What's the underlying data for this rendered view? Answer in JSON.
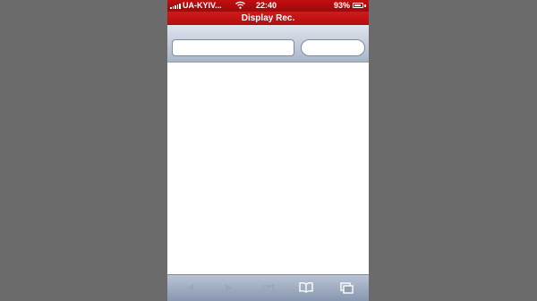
{
  "status_bar": {
    "carrier": "UA-KYIV...",
    "time": "22:40",
    "battery_percent": "93%",
    "battery_level": 0.93,
    "signal_icon": "signal-bars-icon",
    "wifi_icon": "wifi-icon",
    "battery_icon": "battery-icon"
  },
  "title_bar": {
    "title": "Display Rec."
  },
  "url_toolbar": {
    "address_value": "",
    "search_value": ""
  },
  "bottom_toolbar": {
    "buttons": [
      {
        "icon": "back-arrow-icon",
        "enabled": false
      },
      {
        "icon": "forward-arrow-icon",
        "enabled": false
      },
      {
        "icon": "share-icon",
        "enabled": false
      },
      {
        "icon": "bookmarks-icon",
        "enabled": true
      },
      {
        "icon": "tabs-icon",
        "enabled": true
      }
    ]
  },
  "colors": {
    "status_bar": "#9a0a0a",
    "title_bar": "#c00e0e",
    "toolbar": "#a9b5c8",
    "background": "#6b6b6b"
  }
}
